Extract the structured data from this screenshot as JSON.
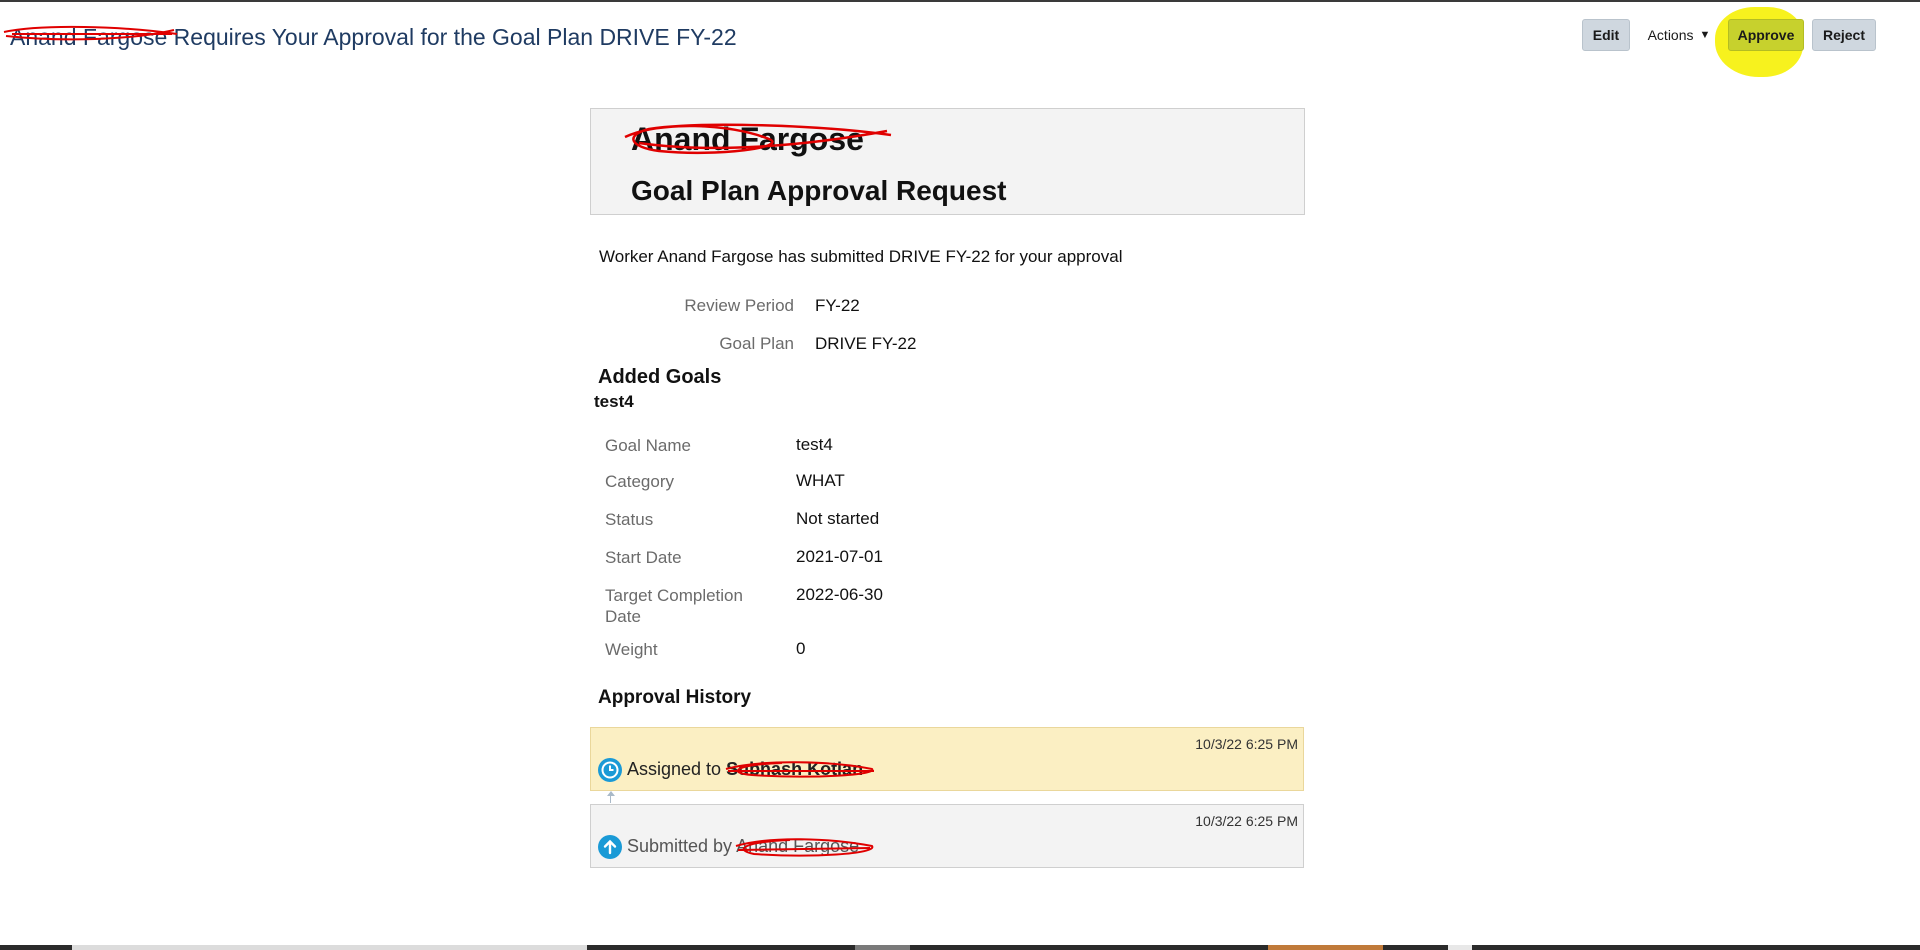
{
  "page": {
    "title_name": "Anand Fargose",
    "title_rest": " Requires Your Approval for the Goal Plan DRIVE FY-22"
  },
  "toolbar": {
    "edit_label": "Edit",
    "actions_label": "Actions",
    "approve_label": "Approve",
    "reject_label": "Reject"
  },
  "header": {
    "worker_name": "Anand Fargose",
    "subtitle": "Goal Plan Approval Request"
  },
  "intro": "Worker Anand Fargose has submitted DRIVE FY-22 for your approval",
  "summary": {
    "review_period_label": "Review Period",
    "review_period_value": "FY-22",
    "goal_plan_label": "Goal Plan",
    "goal_plan_value": "DRIVE FY-22"
  },
  "added_goals": {
    "heading": "Added Goals",
    "goal_title": "test4",
    "fields": [
      {
        "label": "Goal Name",
        "value": "test4"
      },
      {
        "label": "Category",
        "value": "WHAT"
      },
      {
        "label": "Status",
        "value": "Not started"
      },
      {
        "label": "Start Date",
        "value": "2021-07-01"
      },
      {
        "label": "Target Completion Date",
        "value": "2022-06-30"
      },
      {
        "label": "Weight",
        "value": "0"
      }
    ]
  },
  "approval_history": {
    "heading": "Approval History",
    "items": [
      {
        "timestamp": "10/3/22 6:25 PM",
        "prefix": "Assigned to ",
        "person": "Subhash Kotian"
      },
      {
        "timestamp": "10/3/22 6:25 PM",
        "prefix": "Submitted by ",
        "person": "Anand Fargose"
      }
    ]
  },
  "colors": {
    "title_blue": "#1f3b62",
    "highlight_yellow": "#f7f21e",
    "scribble_red": "#e00000",
    "assigned_bg": "#fbefc3",
    "icon_blue": "#1a9ad6"
  }
}
